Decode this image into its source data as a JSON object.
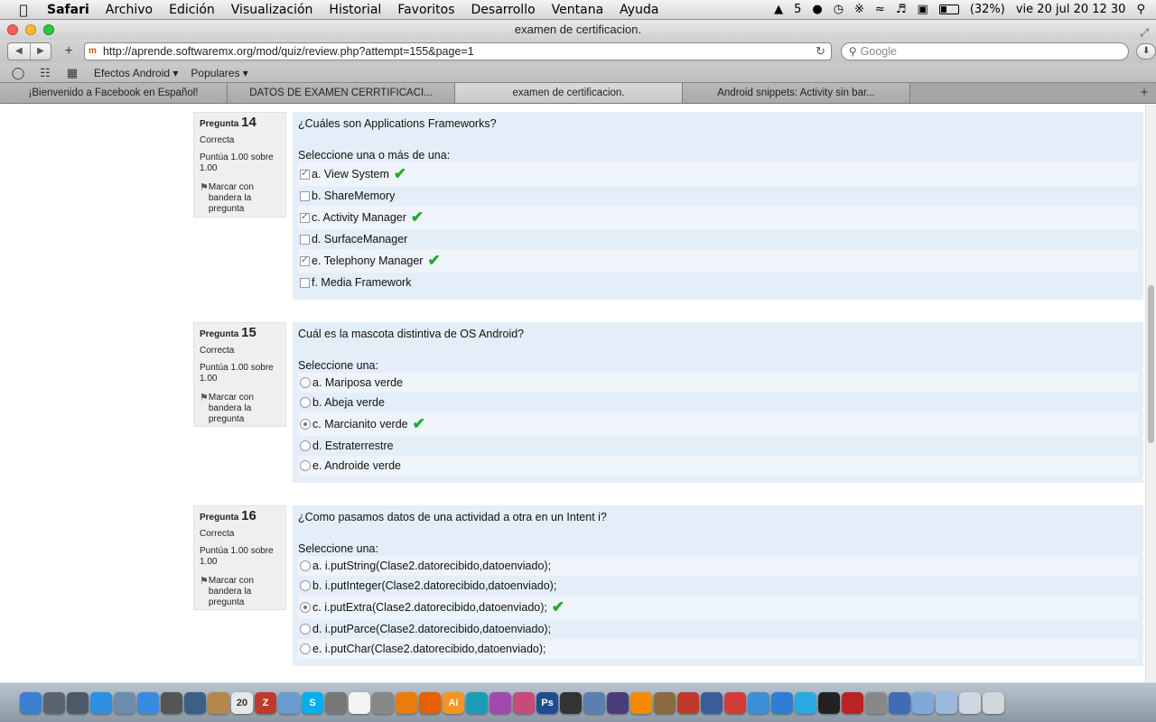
{
  "menubar": {
    "apple": "",
    "items": [
      "Safari",
      "Archivo",
      "Edición",
      "Visualización",
      "Historial",
      "Favoritos",
      "Desarrollo",
      "Ventana",
      "Ayuda"
    ],
    "status": {
      "adobe": "5",
      "battery": "(32%)",
      "clock": "vie 20 jul  20 12 30"
    }
  },
  "window": {
    "title": "examen de certificacion."
  },
  "toolbar": {
    "back": "◀",
    "forward": "▶",
    "new_tab": "+",
    "url": "http://aprende.softwaremx.org/mod/quiz/review.php?attempt=155&page=1",
    "reload": "↻",
    "search_placeholder": "Google",
    "download": "⬇"
  },
  "bookmarks": {
    "items": [
      "Efectos Android ▾",
      "Populares ▾"
    ]
  },
  "tabs": [
    {
      "label": "¡Bienvenido a Facebook en Español!",
      "active": false
    },
    {
      "label": "DATOS DE EXAMEN CERRTIFICACI...",
      "active": false
    },
    {
      "label": "examen de certificacion.",
      "active": true
    },
    {
      "label": "Android snippets: Activity sin bar...",
      "active": false
    }
  ],
  "questions": [
    {
      "label": "Pregunta",
      "number": "14",
      "state": "Correcta",
      "grade": "Puntúa 1.00 sobre 1.00",
      "flag": "Marcar con bandera la pregunta",
      "text": "¿Cuáles son Applications Frameworks?",
      "prompt": "Seleccione una o más de una:",
      "input": "checkbox",
      "options": [
        {
          "text": "a. View System",
          "selected": true,
          "correct": true
        },
        {
          "text": "b. ShareMemory",
          "selected": false,
          "correct": false
        },
        {
          "text": "c. Activity Manager",
          "selected": true,
          "correct": true
        },
        {
          "text": "d. SurfaceManager",
          "selected": false,
          "correct": false
        },
        {
          "text": "e. Telephony Manager",
          "selected": true,
          "correct": true
        },
        {
          "text": "f.  Media Framework",
          "selected": false,
          "correct": false
        }
      ]
    },
    {
      "label": "Pregunta",
      "number": "15",
      "state": "Correcta",
      "grade": "Puntúa 1.00 sobre 1.00",
      "flag": "Marcar con bandera la pregunta",
      "text": "Cuál es la mascota distintiva de OS Android?",
      "prompt": "Seleccione una:",
      "input": "radio",
      "options": [
        {
          "text": "a. Mariposa verde",
          "selected": false,
          "correct": false
        },
        {
          "text": "b. Abeja verde",
          "selected": false,
          "correct": false
        },
        {
          "text": "c. Marcianito verde",
          "selected": true,
          "correct": true
        },
        {
          "text": "d. Estraterrestre",
          "selected": false,
          "correct": false
        },
        {
          "text": "e. Androide verde",
          "selected": false,
          "correct": false
        }
      ]
    },
    {
      "label": "Pregunta",
      "number": "16",
      "state": "Correcta",
      "grade": "Puntúa 1.00 sobre 1.00",
      "flag": "Marcar con bandera la pregunta",
      "text": "¿Como pasamos datos de una actividad a otra en un Intent i?",
      "prompt": "Seleccione una:",
      "input": "radio",
      "options": [
        {
          "text": "a. i.putString(Clase2.datorecibido,datoenviado);",
          "selected": false,
          "correct": false
        },
        {
          "text": "b.  i.putInteger(Clase2.datorecibido,datoenviado);",
          "selected": false,
          "correct": false
        },
        {
          "text": "c. i.putExtra(Clase2.datorecibido,datoenviado);",
          "selected": true,
          "correct": true
        },
        {
          "text": "d. i.putParce(Clase2.datorecibido,datoenviado);",
          "selected": false,
          "correct": false
        },
        {
          "text": "e.  i.putChar(Clase2.datorecibido,datoenviado);",
          "selected": false,
          "correct": false
        }
      ]
    }
  ],
  "dock": [
    {
      "name": "finder",
      "color": "#3b7fd1",
      "glyph": ""
    },
    {
      "name": "launchpad",
      "color": "#5a6470",
      "glyph": ""
    },
    {
      "name": "mission-control",
      "color": "#4d5966",
      "glyph": ""
    },
    {
      "name": "app-store",
      "color": "#2f8fe0",
      "glyph": ""
    },
    {
      "name": "preview",
      "color": "#6c8cae",
      "glyph": ""
    },
    {
      "name": "safari",
      "color": "#3a8be0",
      "glyph": ""
    },
    {
      "name": "facetime",
      "color": "#555",
      "glyph": ""
    },
    {
      "name": "xcode",
      "color": "#3d5f86",
      "glyph": ""
    },
    {
      "name": "contacts",
      "color": "#b5874e",
      "glyph": ""
    },
    {
      "name": "calendar",
      "color": "#e8e8e8",
      "glyph": "20"
    },
    {
      "name": "filezilla",
      "color": "#c0392b",
      "glyph": "Z"
    },
    {
      "name": "virtualbox",
      "color": "#6a9bd0",
      "glyph": ""
    },
    {
      "name": "skype",
      "color": "#00aff0",
      "glyph": "S"
    },
    {
      "name": "tool",
      "color": "#777",
      "glyph": ""
    },
    {
      "name": "textedit",
      "color": "#f4f4f4",
      "glyph": ""
    },
    {
      "name": "scripts",
      "color": "#888",
      "glyph": ""
    },
    {
      "name": "blender",
      "color": "#e87d0d",
      "glyph": ""
    },
    {
      "name": "firefox",
      "color": "#e66000",
      "glyph": ""
    },
    {
      "name": "illustrator",
      "color": "#f7941d",
      "glyph": "Ai"
    },
    {
      "name": "system-prefs",
      "color": "#1c9bb8",
      "glyph": ""
    },
    {
      "name": "indesign",
      "color": "#a04ab0",
      "glyph": ""
    },
    {
      "name": "game",
      "color": "#c64a7a",
      "glyph": ""
    },
    {
      "name": "photoshop",
      "color": "#1f4d8f",
      "glyph": "Ps"
    },
    {
      "name": "unity",
      "color": "#333",
      "glyph": ""
    },
    {
      "name": "virtualbox-2",
      "color": "#5a7fb0",
      "glyph": ""
    },
    {
      "name": "eclipse",
      "color": "#4b3c7a",
      "glyph": ""
    },
    {
      "name": "vlc",
      "color": "#f48b00",
      "glyph": ""
    },
    {
      "name": "gimp",
      "color": "#8a6a40",
      "glyph": ""
    },
    {
      "name": "angry-birds",
      "color": "#c0392b",
      "glyph": ""
    },
    {
      "name": "network",
      "color": "#3a5c9a",
      "glyph": ""
    },
    {
      "name": "cog",
      "color": "#d33b3b",
      "glyph": ""
    },
    {
      "name": "sequel",
      "color": "#3b8fd6",
      "glyph": ""
    },
    {
      "name": "itunes",
      "color": "#2e7ed6",
      "glyph": ""
    },
    {
      "name": "twitter",
      "color": "#2aa9e0",
      "glyph": ""
    },
    {
      "name": "terminal",
      "color": "#222",
      "glyph": ""
    },
    {
      "name": "red-app",
      "color": "#b22",
      "glyph": ""
    },
    {
      "name": "disk-utility",
      "color": "#888",
      "glyph": ""
    },
    {
      "name": "xcode-tools",
      "color": "#3f6db3",
      "glyph": ""
    },
    {
      "name": "downloads-folder",
      "color": "#7fa8d8",
      "glyph": ""
    },
    {
      "name": "documents-folder",
      "color": "#9ab9dc",
      "glyph": ""
    },
    {
      "name": "stack-folder",
      "color": "#cfd8e0",
      "glyph": ""
    },
    {
      "name": "trash",
      "color": "#d0d6db",
      "glyph": ""
    }
  ]
}
